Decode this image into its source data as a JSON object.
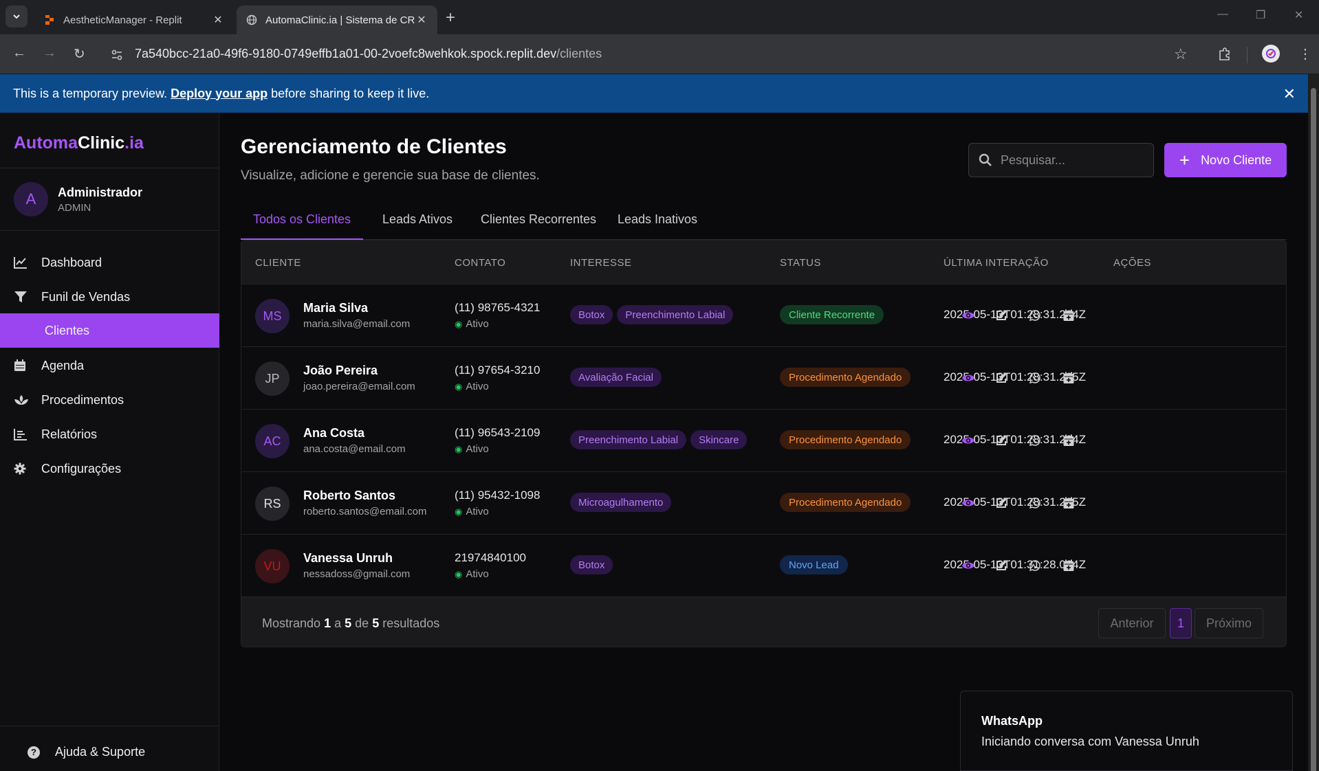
{
  "browser": {
    "tabs": [
      {
        "title": "AestheticManager - Replit",
        "active": false
      },
      {
        "title": "AutomaClinic.ia | Sistema de CRM",
        "active": true
      }
    ],
    "url_host": "7a540bcc-21a0-49f6-9180-0749effb1a01-00-2voefc8wehkok.spock.replit.dev",
    "url_path": "/clientes"
  },
  "banner": {
    "text_before": "This is a temporary preview.",
    "link": "Deploy your app",
    "text_after": "before sharing to keep it live."
  },
  "sidebar": {
    "logo": {
      "part1": "Automa",
      "part2": "Clinic",
      "part3": ".ia"
    },
    "user": {
      "initial": "A",
      "name": "Administrador",
      "role": "ADMIN"
    },
    "items": [
      {
        "label": "Dashboard",
        "icon": "chart-line-icon"
      },
      {
        "label": "Funil de Vendas",
        "icon": "funnel-icon"
      },
      {
        "label": "Clientes",
        "icon": "users-icon",
        "active": true
      },
      {
        "label": "Agenda",
        "icon": "calendar-icon"
      },
      {
        "label": "Procedimentos",
        "icon": "spa-icon"
      },
      {
        "label": "Relatórios",
        "icon": "report-icon"
      },
      {
        "label": "Configurações",
        "icon": "gear-icon"
      }
    ],
    "help": "Ajuda & Suporte"
  },
  "header": {
    "title": "Gerenciamento de Clientes",
    "subtitle": "Visualize, adicione e gerencie sua base de clientes.",
    "search_placeholder": "Pesquisar...",
    "new_button": "Novo Cliente"
  },
  "tabs": [
    "Todos os Clientes",
    "Leads Ativos",
    "Clientes Recorrentes",
    "Leads Inativos"
  ],
  "table": {
    "columns": [
      "CLIENTE",
      "CONTATO",
      "INTERESSE",
      "STATUS",
      "ÚLTIMA INTERAÇÃO",
      "AÇÕES"
    ],
    "rows": [
      {
        "initials": "MS",
        "name": "Maria Silva",
        "email": "maria.silva@email.com",
        "phone": "(11) 98765-4321",
        "contact_status": "Ativo",
        "interests": [
          "Botox",
          "Preenchimento Labial"
        ],
        "status": "Cliente Recorrente",
        "status_color": "#4ade80",
        "last": "2025-05-13T01:28:31.294Z"
      },
      {
        "initials": "JP",
        "name": "João Pereira",
        "email": "joao.pereira@email.com",
        "phone": "(11) 97654-3210",
        "contact_status": "Ativo",
        "interests": [
          "Avaliação Facial"
        ],
        "status": "Procedimento Agendado",
        "status_color": "#fb923c",
        "last": "2025-05-13T01:28:31.295Z"
      },
      {
        "initials": "AC",
        "name": "Ana Costa",
        "email": "ana.costa@email.com",
        "phone": "(11) 96543-2109",
        "contact_status": "Ativo",
        "interests": [
          "Preenchimento Labial",
          "Skincare"
        ],
        "status": "Procedimento Agendado",
        "status_color": "#fb923c",
        "last": "2025-05-13T01:28:31.294Z"
      },
      {
        "initials": "RS",
        "name": "Roberto Santos",
        "email": "roberto.santos@email.com",
        "phone": "(11) 95432-1098",
        "contact_status": "Ativo",
        "interests": [
          "Microagulhamento"
        ],
        "status": "Procedimento Agendado",
        "status_color": "#fb923c",
        "last": "2025-05-13T01:28:31.295Z"
      },
      {
        "initials": "VU",
        "name": "Vanessa Unruh",
        "email": "nessadoss@gmail.com",
        "phone": "21974840100",
        "contact_status": "Ativo",
        "interests": [
          "Botox"
        ],
        "status": "Novo Lead",
        "status_color": "#60a5fa",
        "last": "2025-05-13T01:31:28.004Z"
      }
    ]
  },
  "pagination": {
    "prefix": "Mostrando",
    "from": "1",
    "mid1": "a",
    "to": "5",
    "mid2": "de",
    "total": "5",
    "suffix": "resultados",
    "prev": "Anterior",
    "current": "1",
    "next": "Próximo"
  },
  "toast": {
    "title": "WhatsApp",
    "message": "Iniciando conversa com Vanessa Unruh"
  },
  "colors": {
    "accent": "#9b45f0",
    "banner": "#0c4a8a"
  }
}
